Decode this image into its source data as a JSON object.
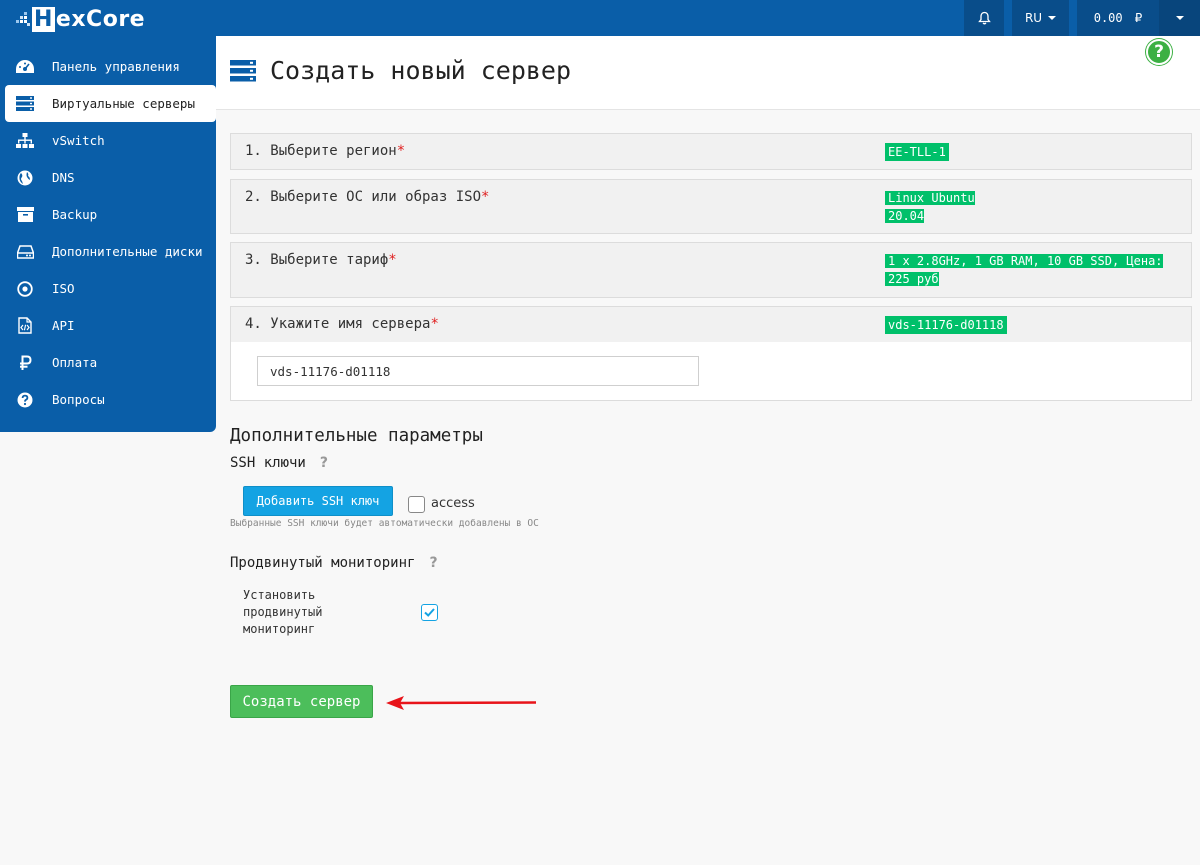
{
  "brand": {
    "name": "HexCore",
    "logo_h": "H",
    "logo_rest": "ex",
    "logo_c": "C",
    "logo_tail": "ore"
  },
  "topbar": {
    "bell_icon": "bell-icon",
    "language": "RU",
    "balance": "0.00",
    "currency_symbol": "₽"
  },
  "sidebar": {
    "items": [
      {
        "label": "Панель управления",
        "icon": "dashboard-icon"
      },
      {
        "label": "Виртуальные серверы",
        "icon": "servers-icon",
        "active": true
      },
      {
        "label": "vSwitch",
        "icon": "network-icon"
      },
      {
        "label": "DNS",
        "icon": "globe-icon"
      },
      {
        "label": "Backup",
        "icon": "archive-icon"
      },
      {
        "label": "Дополнительные диски",
        "icon": "hdd-icon"
      },
      {
        "label": "ISO",
        "icon": "disc-icon"
      },
      {
        "label": "API",
        "icon": "code-file-icon"
      },
      {
        "label": "Оплата",
        "icon": "ruble-icon"
      },
      {
        "label": "Вопросы",
        "icon": "question-icon"
      }
    ]
  },
  "page": {
    "title": "Создать новый сервер",
    "help": "?"
  },
  "steps": [
    {
      "label": "1. Выберите регион",
      "required": "*",
      "value_lines": [
        "EE-TLL-1"
      ]
    },
    {
      "label": "2. Выберите ОС или образ ISO",
      "required": "*",
      "value_lines": [
        "Linux Ubuntu",
        "20.04"
      ]
    },
    {
      "label": "3. Выберите тариф",
      "required": "*",
      "value_lines": [
        "1 x 2.8GHz, 1 GB RAM, 10 GB SSD, Цена:",
        "225 руб"
      ]
    },
    {
      "label": "4. Укажите имя сервера",
      "required": "*",
      "value_lines": [
        "vds-11176-d01118"
      ]
    }
  ],
  "server_name_input": {
    "value": "vds-11176-d01118"
  },
  "additional": {
    "title": "Дополнительные параметры",
    "ssh": {
      "title": "SSH ключи",
      "help": "?",
      "add_button": "Добавить SSH ключ",
      "key_name": "access",
      "key_checked": false,
      "hint": "Выбранные SSH ключи будет автоматически добавлены в ОС"
    },
    "monitoring": {
      "title": "Продвинутый мониторинг",
      "help": "?",
      "install_label": "Установить продвинутый мониторинг",
      "checked": true
    }
  },
  "create_button": "Создать сервер",
  "colors": {
    "brand_blue": "#0a5ea8",
    "accent_green": "#00c06a",
    "button_blue": "#14a3e3",
    "button_green": "#4cbe5b",
    "arrow_red": "#e8141a"
  }
}
